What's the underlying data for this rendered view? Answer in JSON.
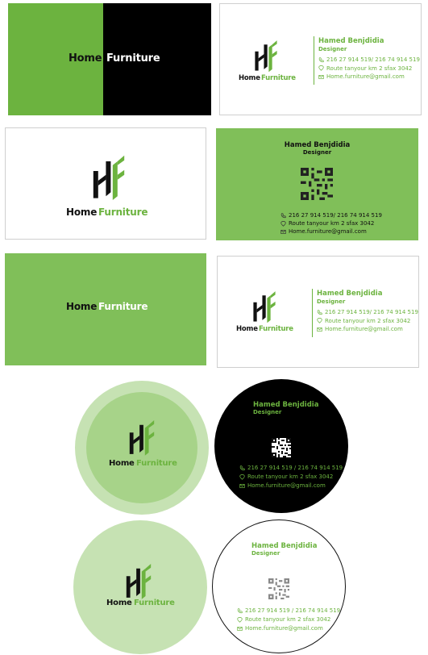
{
  "brand": {
    "word1": "Home",
    "word2": "Furniture",
    "monogram": "HF",
    "green": "#6cb33f",
    "light_green": "#80bf59",
    "pale_green": "#c6e2b3",
    "mid_green": "#a7d389",
    "black": "#000000"
  },
  "contact": {
    "name": "Hamed Benjdidia",
    "role": "Designer",
    "phone": "216 27 914 519/ 216 74 914 519",
    "phone_alt": "216 27 914 519 / 216 74 914 519",
    "address": "Route tanyour km 2 sfax 3042",
    "email": "Home.furniture@gmail.com"
  },
  "icons": [
    "phone-icon",
    "location-pin-icon",
    "mail-icon",
    "qr-code-icon",
    "hf-monogram-icon"
  ]
}
